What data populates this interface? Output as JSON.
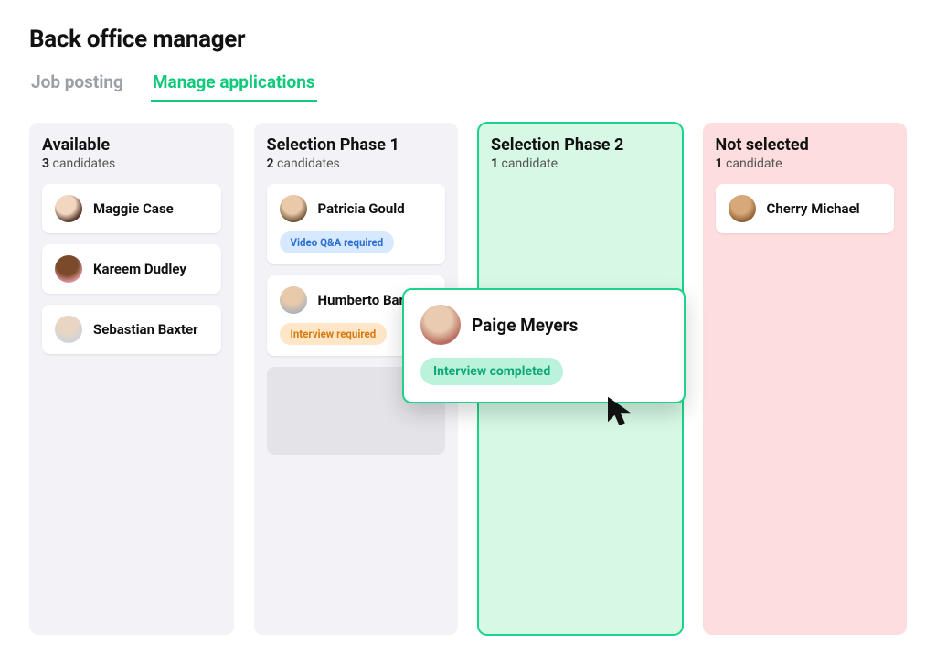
{
  "header": {
    "title": "Back office manager"
  },
  "tabs": {
    "job_posting": "Job posting",
    "manage_applications": "Manage applications"
  },
  "columns": {
    "available": {
      "title": "Available",
      "count": "3",
      "count_word": "candidates",
      "cards": [
        {
          "name": "Maggie Case"
        },
        {
          "name": "Kareem Dudley"
        },
        {
          "name": "Sebastian Baxter"
        }
      ]
    },
    "phase1": {
      "title": "Selection Phase 1",
      "count": "2",
      "count_word": "candidates",
      "cards": [
        {
          "name": "Patricia Gould",
          "badge": "Video Q&A required"
        },
        {
          "name": "Humberto Barre",
          "badge": "Interview required"
        }
      ]
    },
    "phase2": {
      "title": "Selection Phase 2",
      "count": "1",
      "count_word": "candidate"
    },
    "not_selected": {
      "title": "Not selected",
      "count": "1",
      "count_word": "candidate",
      "cards": [
        {
          "name": "Cherry Michael"
        }
      ]
    }
  },
  "dragged": {
    "name": "Paige Meyers",
    "badge": "Interview completed"
  },
  "avatar_colors": {
    "maggie": "radial-gradient(circle at 40% 35%, #f2d6c0 40%, #5b3b2e 70%)",
    "kareem": "radial-gradient(circle at 45% 35%, #7a4a2a 45%, #f4a6b8 80%)",
    "sebastian": "radial-gradient(circle at 45% 30%, #e8d5c4 40%, #d0d4d8 75%)",
    "patricia": "radial-gradient(circle at 45% 35%, #e9c9a7 40%, #6b4e33 75%)",
    "humberto": "radial-gradient(circle at 45% 30%, #e8c9a9 40%, #b0b3b8 75%)",
    "cherry": "radial-gradient(circle at 45% 35%, #d8a978 40%, #8a5a30 75%)",
    "paige": "radial-gradient(circle at 45% 35%, #e8cbb0 38%, #b96c5f 72%)"
  }
}
